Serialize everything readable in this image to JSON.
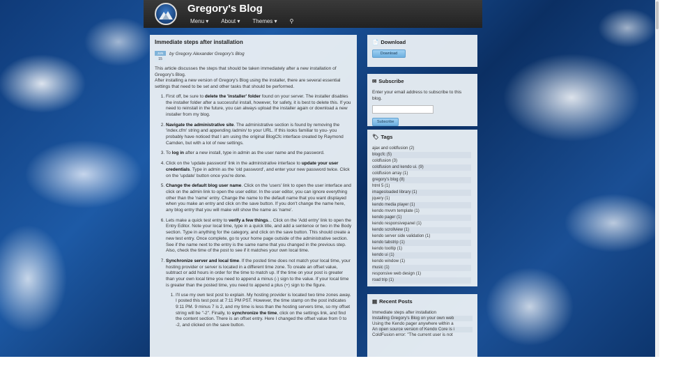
{
  "site": {
    "title": "Gregory's Blog",
    "nav": [
      "Menu ▾",
      "About ▾",
      "Themes ▾"
    ]
  },
  "post": {
    "title": "Immediate steps after installation",
    "date_month": "JUN",
    "date_day": "15",
    "byline": "by Gregory Alexander Gregory's Blog",
    "intro": "This article discusses the steps that should be taken immediately after a new installation of Gregory's Blog.",
    "intro2": "After installing a new version of Gregory's Blog using the installer, there are several essential settings that need to be set and other tasks that should be performed.",
    "steps": [
      {
        "pre": "First off, be sure to ",
        "bold": "delete the 'installer' folder",
        "post": " found on your server. The installer disables the installer folder after a successful install, however, for safety, it is best to delete this. If you need to reinstall in the future, you can always upload the installer again or download a new installer from my blog."
      },
      {
        "pre": "",
        "bold": "Navigate the administrative site",
        "post": ". The administrative section is found by removing the 'index.cfm' string and appending /admin/ to your URL. If this looks familiar to you- you probably have noticed that I am using the original BlogCfc interface created by Raymond Camden, but with a lot of new settings."
      },
      {
        "pre": "To ",
        "bold": "log in",
        "post": " after a new install, type in admin as the user name and the password."
      },
      {
        "pre": "Click on the 'update password' link in the administrative interface to ",
        "bold": "update your user credentials",
        "post": ". Type in admin as the 'old password', and enter your new password twice. Click on the 'update' button once you're done."
      },
      {
        "pre": "",
        "bold": "Change the default blog user name",
        "post": ". Click on the 'users' link to open the user interface and click on the admin link to open the user editor. In the user editor, you can ignore everything other than the 'name' entry. Change the name to the default name that you want displayed when you make an entry and click on the save button. If you don't change the name here, any blog entry that you will make will show the name as 'name'."
      },
      {
        "pre": "Lets make a quick test entry to ",
        "bold": "verify a few things",
        "post": "... Click on the 'Add entry' link to open the Entry Editor. Note your local time, type in a quick title, and add a sentence or two in the Body section. Type in anything for the category, and click on the save button. This should create a new test entry. Once complete, go to your home page outside of the administrative section. See if the name next to the entry is the same name that you changed in the previous step. Also, check the time of the post to see if it matches your own local time."
      },
      {
        "pre": "",
        "bold": "Synchronize server and local time",
        "post": ". If the posted time does not match your local time, your hosting provider or server is located in a different time zone. To create an offset value, subtract or add hours in order for the time to match up. If the time on your post is greater than your own local time you need to append a minus (-) sign to the value. If your local time is greater than the posted time, you need to append a plus (+) sign to the figure."
      }
    ],
    "sub_step": {
      "pre": "I'll use my own test post to explain. My hosting provider is located two time zones away. I posted this test post at 7:11 PM PST. However, the time stamp on the post indicates 9:11 PM. 9 minus 7 is 2, and my time is less than the hosting servers time, so my offset string will be \"-2\". Finally, to ",
      "bold": "synchronize the time",
      "post": ", click on the settings link, and find the content section. There is an offset entry. Here I changed the offset value from 0 to -2, and clicked on the save button."
    }
  },
  "sidebar": {
    "download": {
      "title": "Download",
      "button": "Download"
    },
    "subscribe": {
      "title": "Subscribe",
      "text": "Enter your email address to subscribe to this blog.",
      "button": "Subscribe"
    },
    "tags": {
      "title": "Tags",
      "items": [
        "ajax and coldfusion (2)",
        "blogcfc (5)",
        "coldfusion (3)",
        "coldfusion and kendo ui. (9)",
        "coldfusion array (1)",
        "gregory's blog (8)",
        "html 5 (1)",
        "imagesloaded library (1)",
        "jquery (1)",
        "kendo media player (1)",
        "kendo mvvm template (1)",
        "kendo pager (1)",
        "kendo responsivepanel (1)",
        "kendo scrollview (1)",
        "kendo server side validation (1)",
        "kendo tabstrip (1)",
        "kendo tooltip (1)",
        "kendo ui (1)",
        "kendo window (1)",
        "music (1)",
        "responsive web design (1)",
        "road trip (1)"
      ]
    },
    "recent": {
      "title": "Recent Posts",
      "items": [
        "Immediate steps after installation",
        "Installing Gregory's Blog on your own web",
        "Using the Kendo pager anywhere within a",
        "An open source version of Kendo Core is i",
        "ColdFusion error: \"The current user is not"
      ]
    }
  }
}
